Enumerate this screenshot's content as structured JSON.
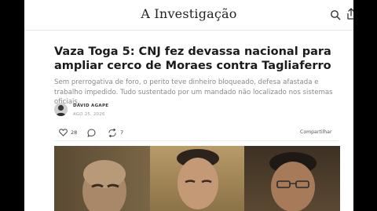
{
  "site": {
    "name": "A Investigação"
  },
  "icons": {
    "search": "search-icon",
    "share": "share-icon",
    "like": "heart-icon",
    "comment": "comment-icon",
    "restack": "restack-icon"
  },
  "article": {
    "headline": "Vaza Toga 5: CNJ fez devassa nacional para ampliar cerco de Moraes contra Tagliaferro",
    "subtitle": "Sem prerrogativa de foro, o perito teve dinheiro bloqueado, defesa afastada e trabalho impedido. Tudo sustentado por um mandado não localizado nos sistemas oficiais.",
    "author": "DAVID AGAPE",
    "date": "AGO 25, 2026"
  },
  "actions": {
    "likes": "28",
    "restacks": "7",
    "share_label": "Compartilhar"
  },
  "colors": {
    "background": "#000000",
    "page": "#ffffff",
    "headline": "#1b1b1b",
    "subtitle": "#8a8a8a",
    "hero": "#6d5a3e"
  }
}
